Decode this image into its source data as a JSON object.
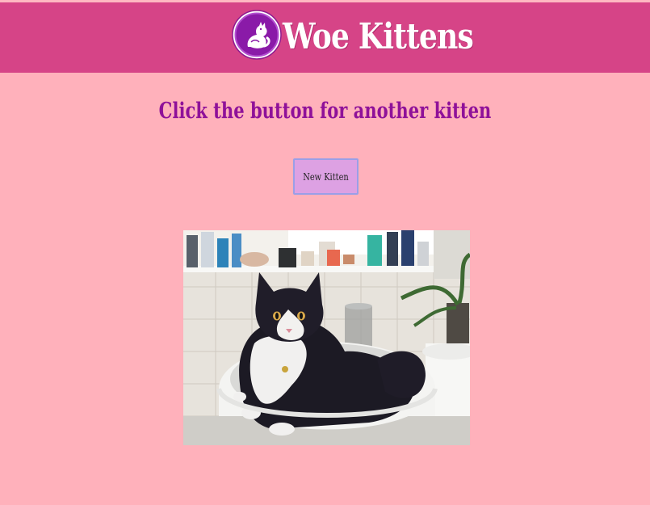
{
  "header": {
    "title": "Woe Kittens",
    "logo_icon": "purple-cat-badge-icon",
    "background_color": "#d64487"
  },
  "main": {
    "prompt": "Click the button for another kitten",
    "prompt_color": "#8f1199",
    "button_label": "New Kitten",
    "button_color": "#dda1e3",
    "photo": "black-and-white-fluffy-cat-sitting-in-bathroom-sink"
  },
  "page": {
    "background_color": "#ffb1bb"
  }
}
